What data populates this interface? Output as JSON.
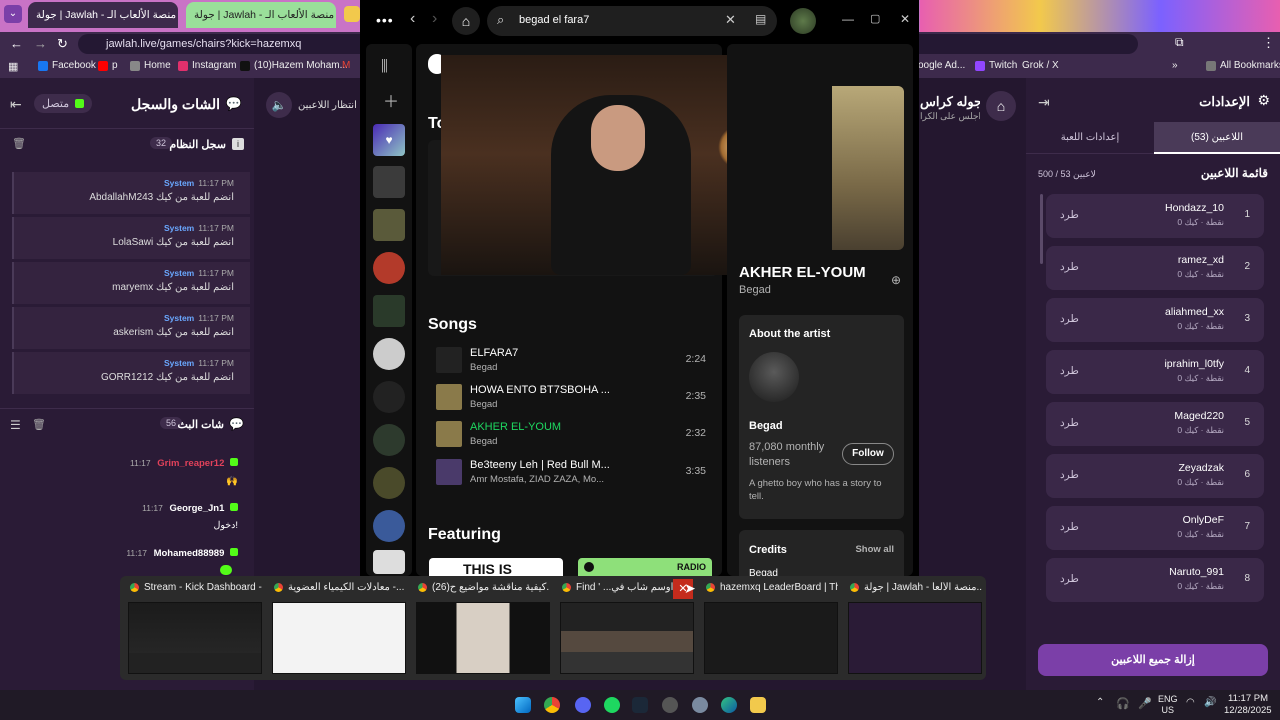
{
  "browser": {
    "tabs": [
      {
        "label": "جولة | Jawlah - منصة الألعاب الـ",
        "active": true
      },
      {
        "label": "جولة | Jawlah - منصة الألعاب الـ",
        "active": false
      }
    ],
    "url": "jawlah.live/games/chairs?kick=hazemxq",
    "bookmarks": [
      "Facebook",
      "p",
      "Home",
      "Instagram",
      "(10)Hazem Moham...",
      "M",
      "oogle Ad...",
      "Twitch",
      "Grok / X"
    ],
    "all_bookmarks": "All Bookmarks"
  },
  "left_panel": {
    "title": "الشات والسجل",
    "status": "متصل",
    "system_log_title": "سجل النظام",
    "system_log_count": "32",
    "system_log_badge": "i",
    "system_messages": [
      {
        "time": "11:17 PM",
        "sender": "System",
        "text": "AbdallahM243 انضم للعبة من كيك"
      },
      {
        "time": "11:17 PM",
        "sender": "System",
        "text": "LolaSawi انضم للعبة من كيك"
      },
      {
        "time": "11:17 PM",
        "sender": "System",
        "text": "maryemx انضم للعبة من كيك"
      },
      {
        "time": "11:17 PM",
        "sender": "System",
        "text": "askerism انضم للعبة من كيك"
      },
      {
        "time": "11:17 PM",
        "sender": "System",
        "text": "GORR1212 انضم للعبة من كيك"
      }
    ],
    "stream_chat_title": "شات البث",
    "stream_chat_count": "56",
    "chat": [
      {
        "time": "11:17",
        "user": "Grim_reaper12",
        "user_color": "#e0415a",
        "text": "🙌"
      },
      {
        "time": "11:17",
        "user": "George_Jn1",
        "user_color": "#ffffff",
        "text": "دخول!"
      },
      {
        "time": "11:17",
        "user": "Mohamed88989",
        "user_color": "#ffffff",
        "text": ""
      }
    ]
  },
  "center": {
    "waiting_text": "انتظار اللاعبين",
    "game_title": "جوله كراس",
    "game_sub": "اجلس على الكرا"
  },
  "right_panel": {
    "title": "الإعدادات",
    "tab_players": "اللاعبين (53)",
    "tab_settings": "إعدادات اللعبة",
    "list_title": "قائمة اللاعبين",
    "count_text": "500 / 53 لاعبين",
    "kick_label": "طرد",
    "players": [
      {
        "rank": "1",
        "name": "Hondazz_10",
        "score": "0 نقطة · كيك"
      },
      {
        "rank": "2",
        "name": "ramez_xd",
        "score": "0 نقطة · كيك"
      },
      {
        "rank": "3",
        "name": "aliahmed_xx",
        "score": "0 نقطة · كيك"
      },
      {
        "rank": "4",
        "name": "iprahim_l0tfy",
        "score": "0 نقطة · كيك"
      },
      {
        "rank": "5",
        "name": "Maged220",
        "score": "0 نقطة · كيك"
      },
      {
        "rank": "6",
        "name": "Zeyadzak",
        "score": "0 نقطة · كيك"
      },
      {
        "rank": "7",
        "name": "OnlyDeF",
        "score": "0 نقطة · كيك"
      },
      {
        "rank": "8",
        "name": "Naruto_991",
        "score": "0 نقطة · كيك"
      }
    ],
    "remove_all": "إزالة جميع اللاعبين"
  },
  "spotify": {
    "search_value": "begad el fara7",
    "section_top": "To",
    "songs_title": "Songs",
    "songs": [
      {
        "title": "ELFARA7",
        "artist": "Begad",
        "duration": "2:24",
        "active": false
      },
      {
        "title": "HOWA ENTO BT7SBOHA ...",
        "artist": "Begad",
        "duration": "2:35",
        "active": false
      },
      {
        "title": "AKHER EL-YOUM",
        "artist": "Begad",
        "duration": "2:32",
        "active": true
      },
      {
        "title": "Be3teeny Leh | Red Bull M...",
        "artist": "Amr Mostafa, ZIAD ZAZA, Mo...",
        "duration": "3:35",
        "active": false
      }
    ],
    "featuring_title": "Featuring",
    "featuring_cards": [
      "THIS IS",
      "RADIO"
    ],
    "now_playing_title": "AKHER EL-YOUM",
    "now_playing_artist": "Begad",
    "about_title": "About the artist",
    "artist_name": "Begad",
    "listeners": "87,080 monthly listeners",
    "follow_label": "Follow",
    "bio": "A ghetto boy who has a story to tell.",
    "credits_title": "Credits",
    "show_all": "Show all",
    "credits_name": "Begad"
  },
  "switcher": [
    {
      "label": "Stream - Kick Dashboard -..."
    },
    {
      "label": "معادلات الكيمياء العضوية -..."
    },
    {
      "label": "(26)كيفية مناقشة مواضيع ح..."
    },
    {
      "label": "Find ' ...اوسم شاب في"
    },
    {
      "label": "hazemxq LeaderBoard | Th..."
    },
    {
      "label": "جولة | Jawlah - منصة الألعا..."
    }
  ],
  "taskbar": {
    "lang": "ENG",
    "region": "US",
    "time": "11:17 PM",
    "date": "12/28/2025"
  },
  "colors": {
    "kick_green": "#53fc18",
    "spotify_green": "#1ed760",
    "purple_accent": "#7b3fa8"
  }
}
